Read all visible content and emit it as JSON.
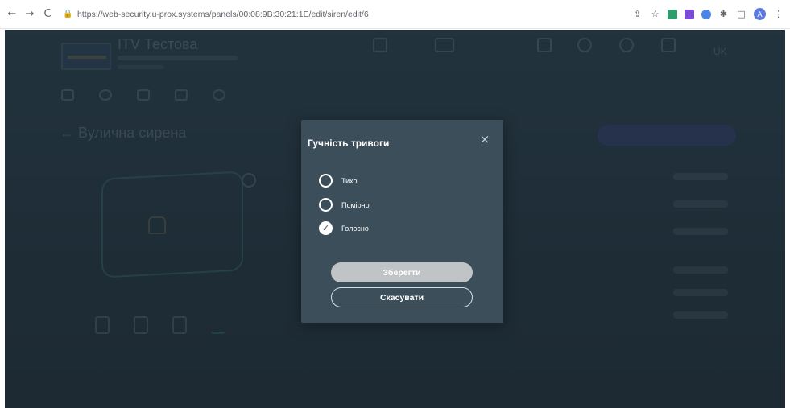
{
  "browser": {
    "url": "https://web-security.u-prox.systems/panels/00:08:9B:30:21:1E/edit/siren/edit/6",
    "back_icon": "←",
    "forward_icon": "→",
    "reload_icon": "C",
    "lock_icon": "lock-icon",
    "profile_initial": "A",
    "extension_colors": [
      "#2e9c6b",
      "#7b4bd6",
      "#4a84e8"
    ]
  },
  "modal": {
    "title": "Гучність тривоги",
    "close_icon": "×",
    "options": [
      {
        "label": "Тихо",
        "checked": false
      },
      {
        "label": "Помірно",
        "checked": false
      },
      {
        "label": "Голосно",
        "checked": true
      }
    ],
    "check_glyph": "✓",
    "save_label": "Зберегти",
    "cancel_label": "Скасувати"
  },
  "colors": {
    "accent": "#5a4fd6",
    "teal": "#5ad1c5",
    "modal_bg": "#3b4e5a"
  }
}
